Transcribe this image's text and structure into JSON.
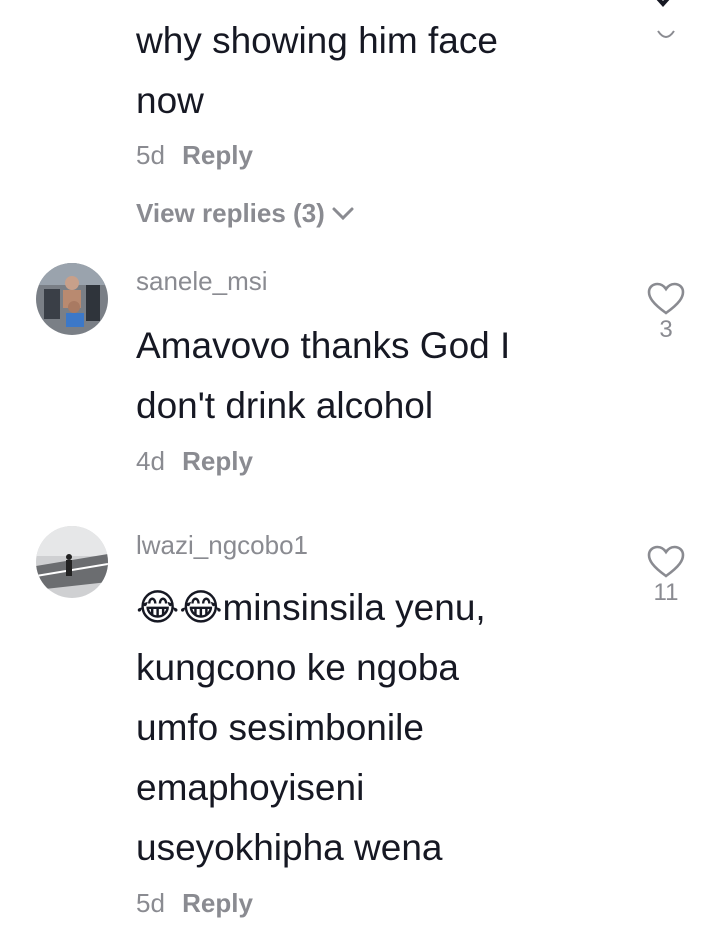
{
  "top_comment": {
    "text_line1": "why showing him face",
    "text_line2": "now",
    "time": "5d",
    "reply_label": "Reply",
    "view_replies": "View replies (3)"
  },
  "comments": [
    {
      "username": "sanele_msi",
      "text_lines": [
        "Amavovo thanks God I",
        "don't drink alcohol"
      ],
      "time": "4d",
      "reply_label": "Reply",
      "likes": "3"
    },
    {
      "username": "lwazi_ngcobo1",
      "emoji": "😂😂",
      "text_lines": [
        "minsinsila yenu,",
        "kungcono ke ngoba",
        "umfo sesimbonile",
        "emaphoyiseni",
        "useyokhipha wena"
      ],
      "time": "5d",
      "reply_label": "Reply",
      "likes": "11"
    }
  ],
  "colors": {
    "text": "#161823",
    "muted": "#8a8b91"
  },
  "icons": {
    "close": "close-icon",
    "like": "heart-outline-icon",
    "expand": "chevron-down-icon"
  }
}
